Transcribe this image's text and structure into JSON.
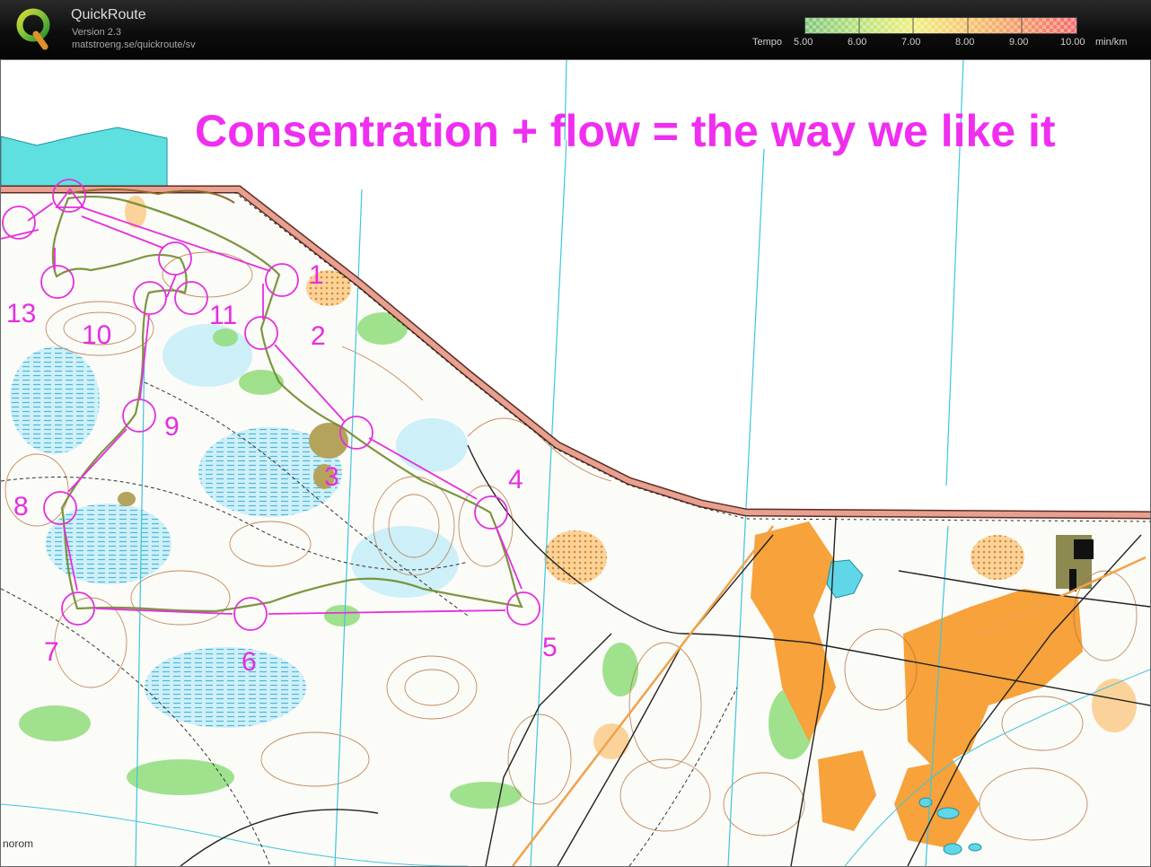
{
  "app": {
    "name": "QuickRoute",
    "version": "Version 2.3",
    "url": "matstroeng.se/quickroute/sv"
  },
  "pace_legend": {
    "label": "Tempo",
    "ticks": [
      "5.00",
      "6.00",
      "7.00",
      "8.00",
      "9.00",
      "10.00"
    ],
    "unit": "min/km",
    "colors": [
      "#7fc77a",
      "#b9e27b",
      "#f1ef7e",
      "#f7c66e",
      "#f49868",
      "#f36d6d"
    ]
  },
  "map": {
    "headline": "Consentration + flow = the way we like it",
    "corner_label": "norom",
    "course_color": "#e52ee0",
    "controls": [
      {
        "n": "1"
      },
      {
        "n": "2"
      },
      {
        "n": "3"
      },
      {
        "n": "4"
      },
      {
        "n": "5"
      },
      {
        "n": "6"
      },
      {
        "n": "7"
      },
      {
        "n": "8"
      },
      {
        "n": "9"
      },
      {
        "n": "10"
      },
      {
        "n": "11"
      },
      {
        "n": "13"
      }
    ]
  }
}
